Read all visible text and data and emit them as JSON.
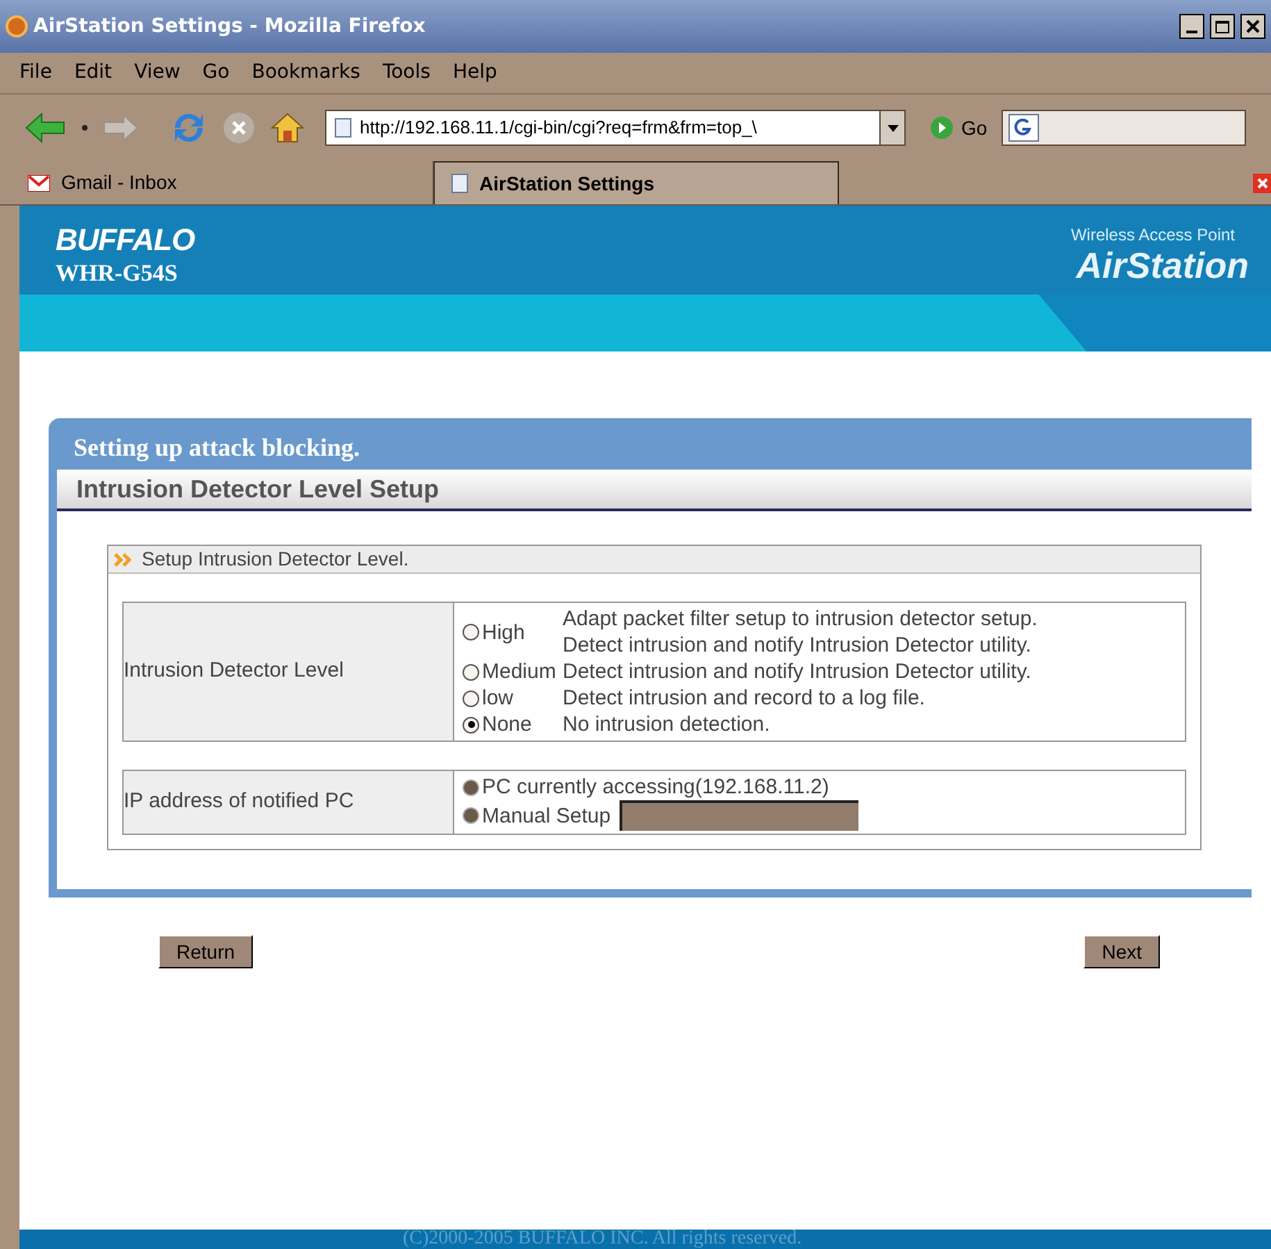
{
  "window": {
    "title": "AirStation Settings - Mozilla Firefox"
  },
  "menu": [
    "File",
    "Edit",
    "View",
    "Go",
    "Bookmarks",
    "Tools",
    "Help"
  ],
  "toolbar": {
    "url": "http://192.168.11.1/cgi-bin/cgi?req=frm&frm=top_\\",
    "go": "Go"
  },
  "tabs": [
    {
      "label": "Gmail - Inbox",
      "selected": false,
      "kind": "mail"
    },
    {
      "label": "AirStation Settings",
      "selected": true,
      "kind": "page"
    }
  ],
  "header": {
    "brand": "BUFFALO",
    "model": "WHR-G54S",
    "tagline": "Wireless Access Point",
    "product": "AirStation"
  },
  "panel": {
    "title": "Setting up attack blocking.",
    "subtitle": "Intrusion Detector Level Setup",
    "section": "Setup Intrusion Detector Level.",
    "level_row": {
      "label": "Intrusion Detector Level",
      "options": [
        {
          "label": "High",
          "description": [
            "Adapt packet filter setup to intrusion detector setup.",
            "Detect intrusion and notify Intrusion Detector utility."
          ],
          "selected": false
        },
        {
          "label": "Medium",
          "description": [
            "Detect intrusion and notify Intrusion Detector utility."
          ],
          "selected": false
        },
        {
          "label": "low",
          "description": [
            "Detect intrusion and record to a log file."
          ],
          "selected": false
        },
        {
          "label": "None",
          "description": [
            "No intrusion detection."
          ],
          "selected": true
        }
      ]
    },
    "ip_row": {
      "label": "IP address of notified PC",
      "options": [
        {
          "label": "PC currently accessing(192.168.11.2)",
          "kind": "plain",
          "disabled": true
        },
        {
          "label": "Manual Setup",
          "kind": "field",
          "disabled": true
        }
      ]
    }
  },
  "buttons": [
    "Return",
    "Next"
  ],
  "footer": "(C)2000-2005 BUFFALO INC. All rights reserved."
}
